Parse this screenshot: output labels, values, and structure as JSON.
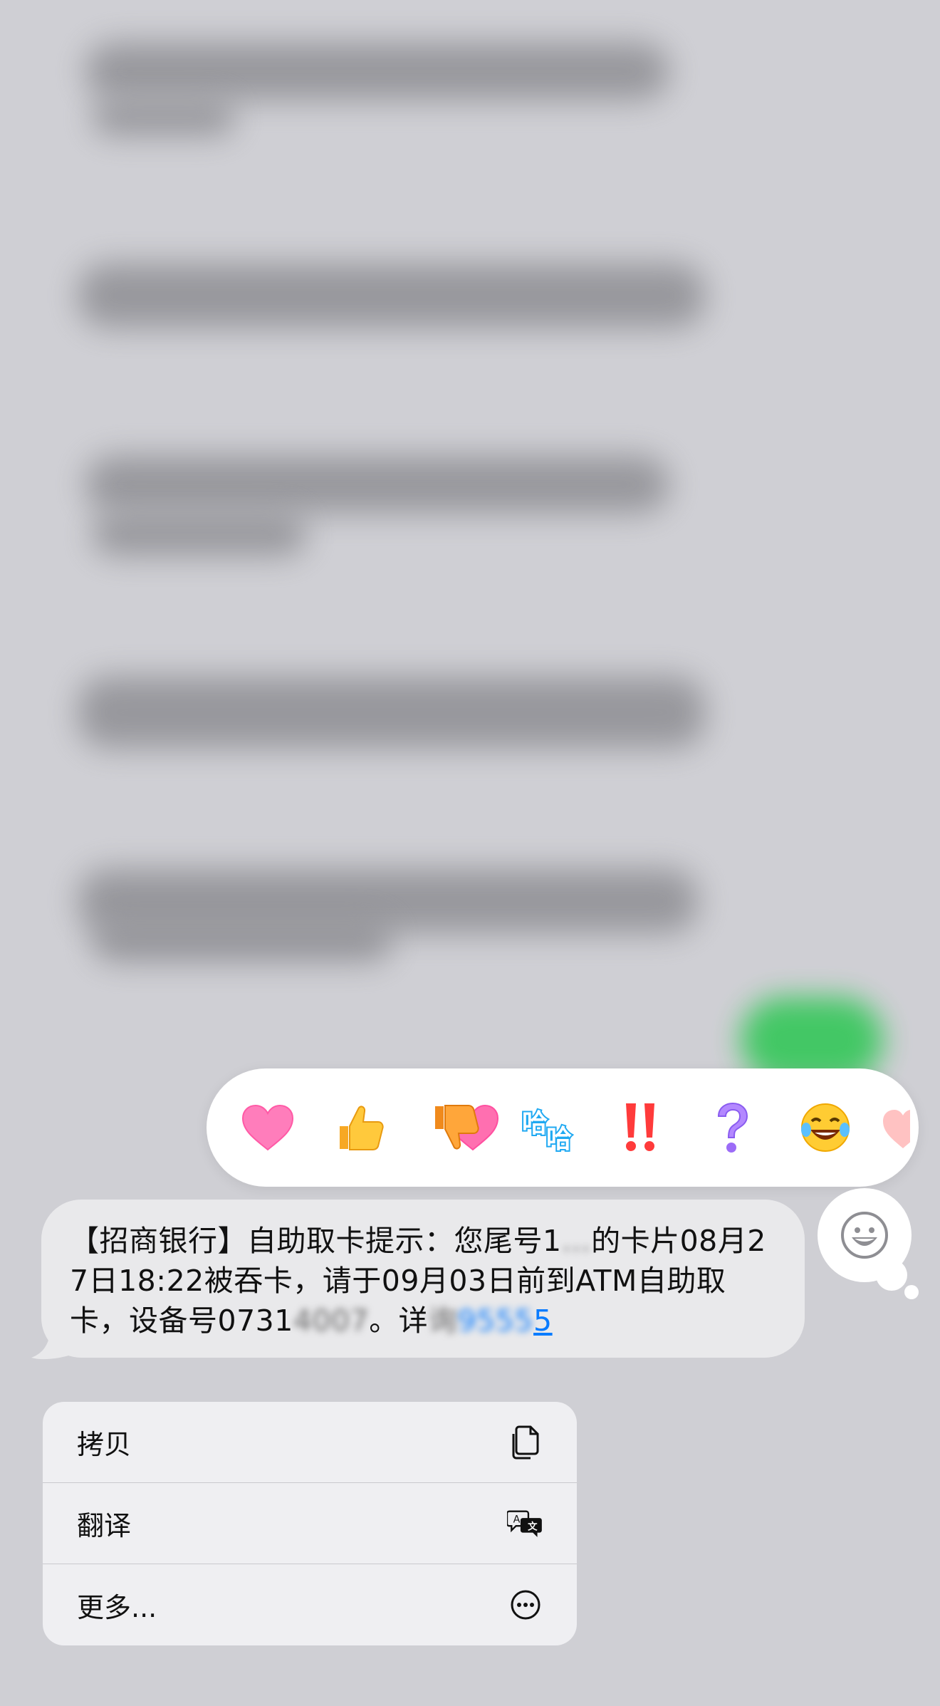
{
  "reactions": [
    {
      "name": "heart",
      "glyph": "❤"
    },
    {
      "name": "thumbs-up",
      "glyph": "👍"
    },
    {
      "name": "thumbs-down",
      "glyph": "👎"
    },
    {
      "name": "haha",
      "label": "哈哈"
    },
    {
      "name": "exclamation",
      "label": "‼"
    },
    {
      "name": "question",
      "label": "?"
    },
    {
      "name": "laughing",
      "glyph": "😂"
    }
  ],
  "message": {
    "part1": "【招商银行】自助取卡提示：您尾号1",
    "smudge1": "…",
    "part2": "的卡片08月27日18:22被吞卡，请于09月03日前到ATM自助取卡，设备号0731",
    "smudge2": "4007",
    "part3": "。详",
    "smudge3": "询",
    "link_visible": "95",
    "link_smudge": "55",
    "link_end": "5"
  },
  "menu": {
    "items": [
      {
        "label": "拷贝",
        "icon": "copy-icon"
      },
      {
        "label": "翻译",
        "icon": "translate-icon"
      },
      {
        "label": "更多...",
        "icon": "more-icon"
      }
    ]
  },
  "colors": {
    "background": "#cfcfd4",
    "bubble_incoming": "#e9e9eb",
    "link": "#0a7cff",
    "reaction_accent": "#0a7cff"
  }
}
